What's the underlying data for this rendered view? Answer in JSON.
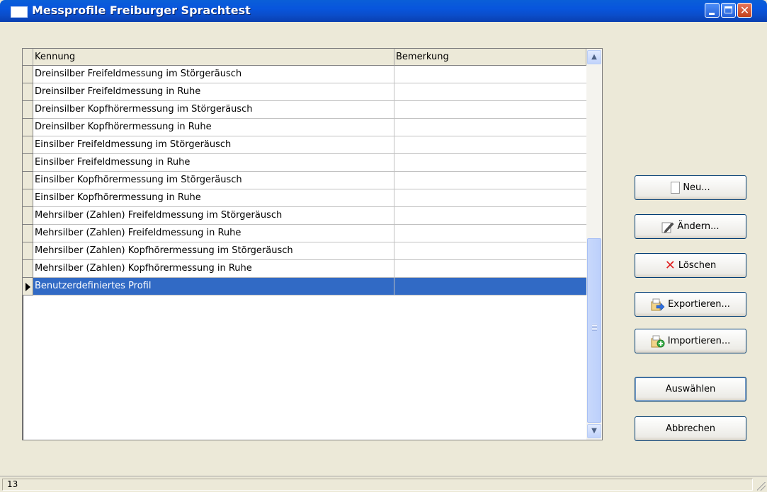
{
  "window": {
    "title": "Messprofile Freiburger Sprachtest",
    "controls": [
      "minimize-icon",
      "maximize-icon",
      "close-icon"
    ],
    "title_bar_color": "#0a5fd8"
  },
  "grid": {
    "columns": [
      "Kennung",
      "Bemerkung"
    ],
    "rows": [
      {
        "kennung": "Dreinsilber Freifeldmessung im Störgeräusch",
        "bemerkung": ""
      },
      {
        "kennung": "Dreinsilber Freifeldmessung in Ruhe",
        "bemerkung": ""
      },
      {
        "kennung": "Dreinsilber Kopfhörermessung im Störgeräusch",
        "bemerkung": ""
      },
      {
        "kennung": "Dreinsilber Kopfhörermessung in Ruhe",
        "bemerkung": ""
      },
      {
        "kennung": "Einsilber Freifeldmessung im Störgeräusch",
        "bemerkung": ""
      },
      {
        "kennung": "Einsilber Freifeldmessung in Ruhe",
        "bemerkung": ""
      },
      {
        "kennung": "Einsilber Kopfhörermessung im Störgeräusch",
        "bemerkung": ""
      },
      {
        "kennung": "Einsilber Kopfhörermessung in Ruhe",
        "bemerkung": ""
      },
      {
        "kennung": "Mehrsilber (Zahlen) Freifeldmessung im Störgeräusch",
        "bemerkung": ""
      },
      {
        "kennung": "Mehrsilber (Zahlen) Freifeldmessung in Ruhe",
        "bemerkung": ""
      },
      {
        "kennung": "Mehrsilber (Zahlen) Kopfhörermessung im Störgeräusch",
        "bemerkung": ""
      },
      {
        "kennung": "Mehrsilber (Zahlen) Kopfhörermessung in Ruhe",
        "bemerkung": ""
      },
      {
        "kennung": "Benutzerdefiniertes Profil",
        "bemerkung": ""
      }
    ],
    "selected_color": "#316ac5"
  },
  "buttons": {
    "new": "Neu...",
    "edit": "Ändern...",
    "delete": "Löschen",
    "export": "Exportieren...",
    "import": "Importieren...",
    "select": "Auswählen",
    "cancel": "Abbrechen"
  },
  "statusbar": {
    "text": "13"
  }
}
